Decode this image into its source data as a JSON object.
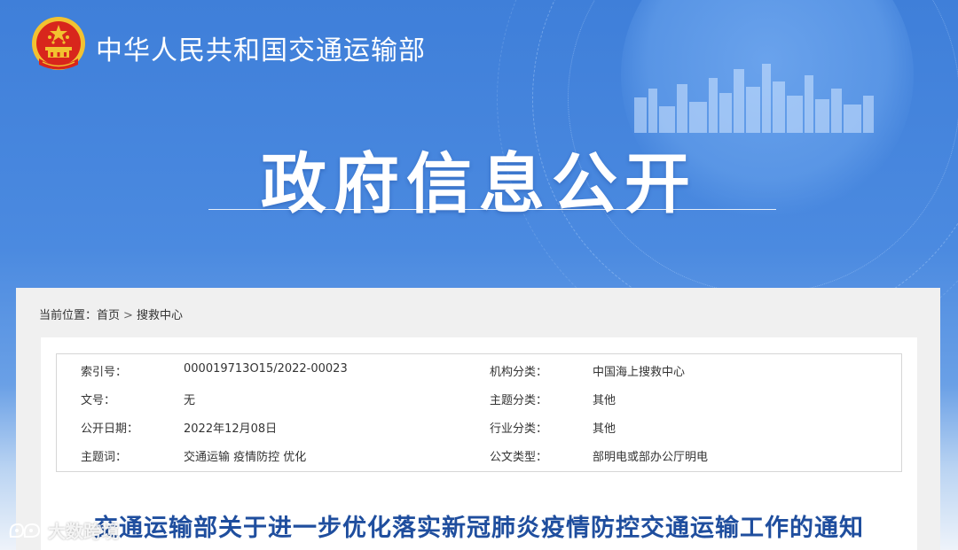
{
  "header": {
    "ministry_name": "中华人民共和国交通运输部",
    "banner_title": "政府信息公开"
  },
  "breadcrumb": {
    "label": "当前位置：",
    "items": [
      "首页",
      "搜救中心"
    ],
    "separator": ">"
  },
  "metadata": [
    {
      "k1": "索引号：",
      "v1": "000019713O15/2022-00023",
      "k2": "机构分类：",
      "v2": "中国海上搜救中心"
    },
    {
      "k1": "文号：",
      "v1": "无",
      "k2": "主题分类：",
      "v2": "其他"
    },
    {
      "k1": "公开日期：",
      "v1": "2022年12月08日",
      "k2": "行业分类：",
      "v2": "其他"
    },
    {
      "k1": "主题词：",
      "v1": "交通运输 疫情防控 优化",
      "k2": "公文类型：",
      "v2": "部明电或部办公厅明电"
    }
  ],
  "document": {
    "title": "交通运输部关于进一步优化落实新冠肺炎疫情防控交通运输工作的通知"
  },
  "watermark": {
    "text": "大数跨境"
  },
  "colors": {
    "banner": "#4b8ae0",
    "title_blue": "#1f4e9e",
    "emblem_red": "#d8261c",
    "emblem_gold": "#f2c230"
  }
}
